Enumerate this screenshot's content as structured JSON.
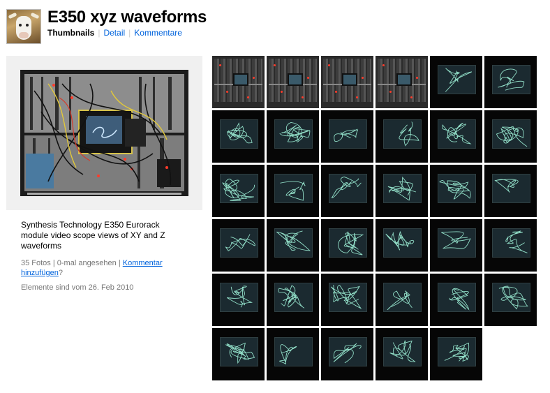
{
  "header": {
    "title": "E350 xyz waveforms",
    "nav": {
      "thumbnails": "Thumbnails",
      "detail": "Detail",
      "comments": "Kommentare"
    }
  },
  "set": {
    "description": "Synthesis Technology E350 Eurorack module video scope views of XY and Z waveforms",
    "stats": "35 Fotos | 0-mal angesehen | ",
    "add_comment_link": "Kommentar hinzufügen",
    "add_comment_suffix": "?",
    "date": "Elemente sind vom 26. Feb 2010"
  },
  "thumbnails": {
    "count": 35,
    "columns": 6,
    "rack_photos": 4
  },
  "colors": {
    "link": "#0063dc",
    "trace": "#9ff2d8",
    "panel_bg": "#f0f0f0"
  }
}
